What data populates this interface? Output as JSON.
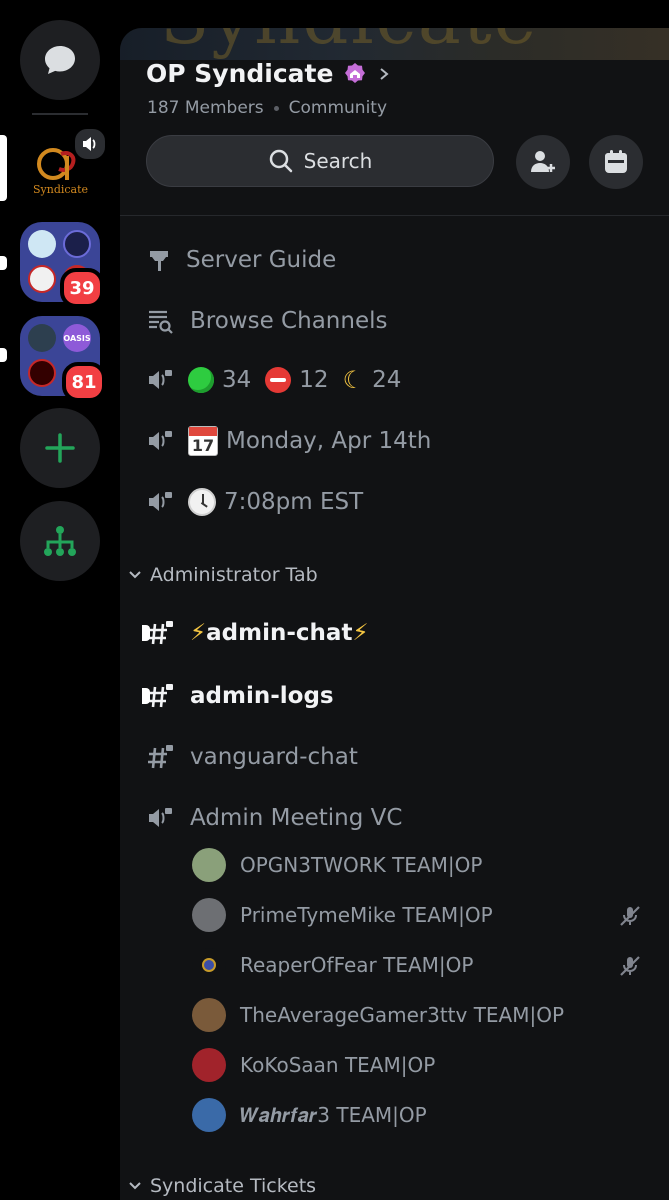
{
  "rail": {
    "folder1_badge": "39",
    "folder2_badge": "81",
    "folder2_label": "OASIS"
  },
  "server": {
    "name": "OP Syndicate",
    "members": "187 Members",
    "type": "Community",
    "banner_text": "Syndicate",
    "search_label": "Search"
  },
  "channels": {
    "server_guide": "Server Guide",
    "browse_channels": "Browse Channels",
    "stats": {
      "online": "34",
      "dnd": "12",
      "idle": "24"
    },
    "calendar_day": "17",
    "date": "Monday, Apr 14th",
    "time": "7:08pm EST"
  },
  "categories": {
    "admin": "Administrator Tab",
    "tickets": "Syndicate Tickets"
  },
  "admin_channels": [
    {
      "label": "admin-chat",
      "prefix": "⚡",
      "suffix": "⚡"
    },
    {
      "label": "admin-logs"
    },
    {
      "label": "vanguard-chat"
    },
    {
      "label": "Admin Meeting VC"
    }
  ],
  "vc_users": [
    {
      "name": "OPGN3TWORK TEAM|OP",
      "muted": false,
      "color": "#8aa07a"
    },
    {
      "name": "PrimeTymeMike TEAM|OP",
      "muted": true,
      "color": "#6d6f73"
    },
    {
      "name": "ReaperOfFear TEAM|OP",
      "muted": true,
      "color": "#1c2540"
    },
    {
      "name": "TheAverageGamer3ttv TEAM|OP",
      "muted": false,
      "color": "#7a5a3a"
    },
    {
      "name": "KoKoSaan TEAM|OP",
      "muted": false,
      "color": "#a1232b"
    },
    {
      "name": "𝑾𝒂𝒉𝒓𝒇𝒂𝒓3 TEAM|OP",
      "muted": false,
      "color": "#3a6aa8"
    }
  ],
  "colors": {
    "accent": "#5865f2",
    "badge": "#f23f43",
    "add": "#23a55a"
  }
}
